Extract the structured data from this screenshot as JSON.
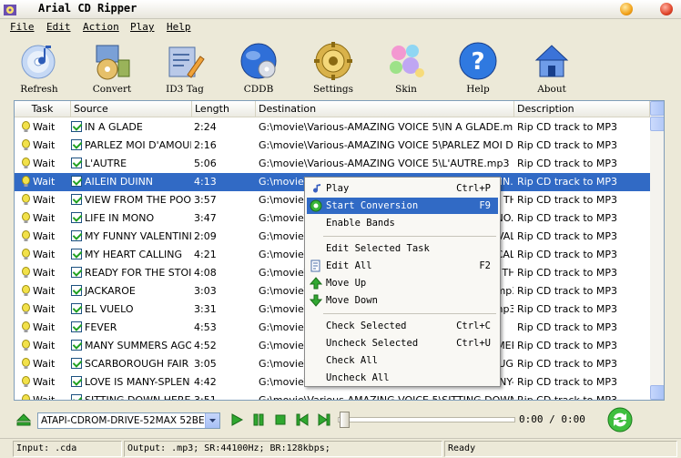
{
  "window": {
    "title": "Arial CD Ripper"
  },
  "menu": [
    "File",
    "Edit",
    "Action",
    "Play",
    "Help"
  ],
  "toolbar": [
    {
      "label": "Refresh",
      "icon": "cd-refresh-icon"
    },
    {
      "label": "Convert",
      "icon": "convert-icon"
    },
    {
      "label": "ID3 Tag",
      "icon": "id3-tag-icon"
    },
    {
      "label": "CDDB",
      "icon": "cddb-globe-icon"
    },
    {
      "label": "Settings",
      "icon": "settings-gear-icon"
    },
    {
      "label": "Skin",
      "icon": "skin-bubbles-icon"
    },
    {
      "label": "Help",
      "icon": "help-icon"
    },
    {
      "label": "About",
      "icon": "about-house-icon"
    }
  ],
  "columns": [
    "Task",
    "Source",
    "Length",
    "Destination",
    "Description"
  ],
  "rows": [
    {
      "task": "Wait",
      "source": "IN A GLADE",
      "length": "2:24",
      "dest": "G:\\movie\\Various-AMAZING VOICE 5\\IN A GLADE.mp3",
      "desc": "Rip CD track to MP3"
    },
    {
      "task": "Wait",
      "source": "PARLEZ MOI D'AMOUR",
      "length": "2:16",
      "dest": "G:\\movie\\Various-AMAZING VOICE 5\\PARLEZ MOI D'AM",
      "desc": "Rip CD track to MP3"
    },
    {
      "task": "Wait",
      "source": "L'AUTRE",
      "length": "5:06",
      "dest": "G:\\movie\\Various-AMAZING VOICE 5\\L'AUTRE.mp3",
      "desc": "Rip CD track to MP3"
    },
    {
      "task": "Wait",
      "source": "AILEIN DUINN",
      "length": "4:13",
      "dest": "G:\\movie\\Various-AMAZING VOICE 5\\AILEIN DUINN.mp3",
      "desc": "Rip CD track to MP3"
    },
    {
      "task": "Wait",
      "source": "VIEW FROM THE POO",
      "length": "3:57",
      "dest": "G:\\movie\\Various-AMAZING VOICE 5\\VIEW FROM THE P",
      "desc": "Rip CD track to MP3"
    },
    {
      "task": "Wait",
      "source": "LIFE IN MONO",
      "length": "3:47",
      "dest": "G:\\movie\\Various-AMAZING VOICE 5\\LIFE IN MONO.mp3",
      "desc": "Rip CD track to MP3"
    },
    {
      "task": "Wait",
      "source": "MY FUNNY VALENTINI",
      "length": "2:09",
      "dest": "G:\\movie\\Various-AMAZING VOICE 5\\MY FUNNY VALENTIN",
      "desc": "Rip CD track to MP3"
    },
    {
      "task": "Wait",
      "source": "MY HEART CALLING",
      "length": "4:21",
      "dest": "G:\\movie\\Various-AMAZING VOICE 5\\MY HEART CALLIN",
      "desc": "Rip CD track to MP3"
    },
    {
      "task": "Wait",
      "source": "READY FOR THE STOI",
      "length": "4:08",
      "dest": "G:\\movie\\Various-AMAZING VOICE 5\\READY FOR THE S",
      "desc": "Rip CD track to MP3"
    },
    {
      "task": "Wait",
      "source": "JACKAROE",
      "length": "3:03",
      "dest": "G:\\movie\\Various-AMAZING VOICE 5\\JACKAROE.mp3",
      "desc": "Rip CD track to MP3"
    },
    {
      "task": "Wait",
      "source": "EL VUELO",
      "length": "3:31",
      "dest": "G:\\movie\\Various-AMAZING VOICE 5\\EL VUELO.mp3",
      "desc": "Rip CD track to MP3"
    },
    {
      "task": "Wait",
      "source": "FEVER",
      "length": "4:53",
      "dest": "G:\\movie\\Various-AMAZING VOICE 5\\FEVER.mp3",
      "desc": "Rip CD track to MP3"
    },
    {
      "task": "Wait",
      "source": "MANY SUMMERS AGO",
      "length": "4:52",
      "dest": "G:\\movie\\Various-AMAZING VOICE 5\\MANY SUMMERS AG",
      "desc": "Rip CD track to MP3"
    },
    {
      "task": "Wait",
      "source": "SCARBOROUGH FAIR",
      "length": "3:05",
      "dest": "G:\\movie\\Various-AMAZING VOICE 5\\SCARBOROUGH FAIR",
      "desc": "Rip CD track to MP3"
    },
    {
      "task": "Wait",
      "source": "LOVE IS MANY-SPLEN",
      "length": "4:42",
      "dest": "G:\\movie\\Various-AMAZING VOICE 5\\LOVE IS MANY-SPLEN",
      "desc": "Rip CD track to MP3"
    },
    {
      "task": "Wait",
      "source": "SITTING DOWN HERE",
      "length": "3:51",
      "dest": "G:\\movie\\Various-AMAZING VOICE 5\\SITTING DOWN H",
      "desc": "Rip CD track to MP3"
    }
  ],
  "selected_row": 3,
  "context_menu": [
    {
      "label": "Play",
      "shortcut": "Ctrl+P",
      "icon": "music-note-icon"
    },
    {
      "label": "Start Conversion",
      "shortcut": "F9",
      "icon": "convert-gear-icon",
      "highlighted": true
    },
    {
      "label": "Enable Bands",
      "shortcut": ""
    },
    {
      "sep": true
    },
    {
      "label": "Edit Selected Task",
      "shortcut": ""
    },
    {
      "label": "Edit All",
      "shortcut": "F2",
      "icon": "edit-doc-icon"
    },
    {
      "label": "Move Up",
      "shortcut": "",
      "icon": "arrow-up-icon"
    },
    {
      "label": "Move Down",
      "shortcut": "",
      "icon": "arrow-down-icon"
    },
    {
      "sep": true
    },
    {
      "label": "Check Selected",
      "shortcut": "Ctrl+C"
    },
    {
      "label": "Uncheck Selected",
      "shortcut": "Ctrl+U"
    },
    {
      "label": "Check All",
      "shortcut": ""
    },
    {
      "label": "Uncheck All",
      "shortcut": ""
    }
  ],
  "transport": {
    "drive": "ATAPI-CDROM-DRIVE-52MAX 52BE",
    "time": "0:00 / 0:00",
    "position": 0
  },
  "status": {
    "input": "Input: .cda",
    "output": "Output: .mp3; SR:44100Hz; BR:128kbps;",
    "state": "Ready"
  },
  "colors": {
    "selection": "#316ac5",
    "accent_green": "#21a121"
  }
}
